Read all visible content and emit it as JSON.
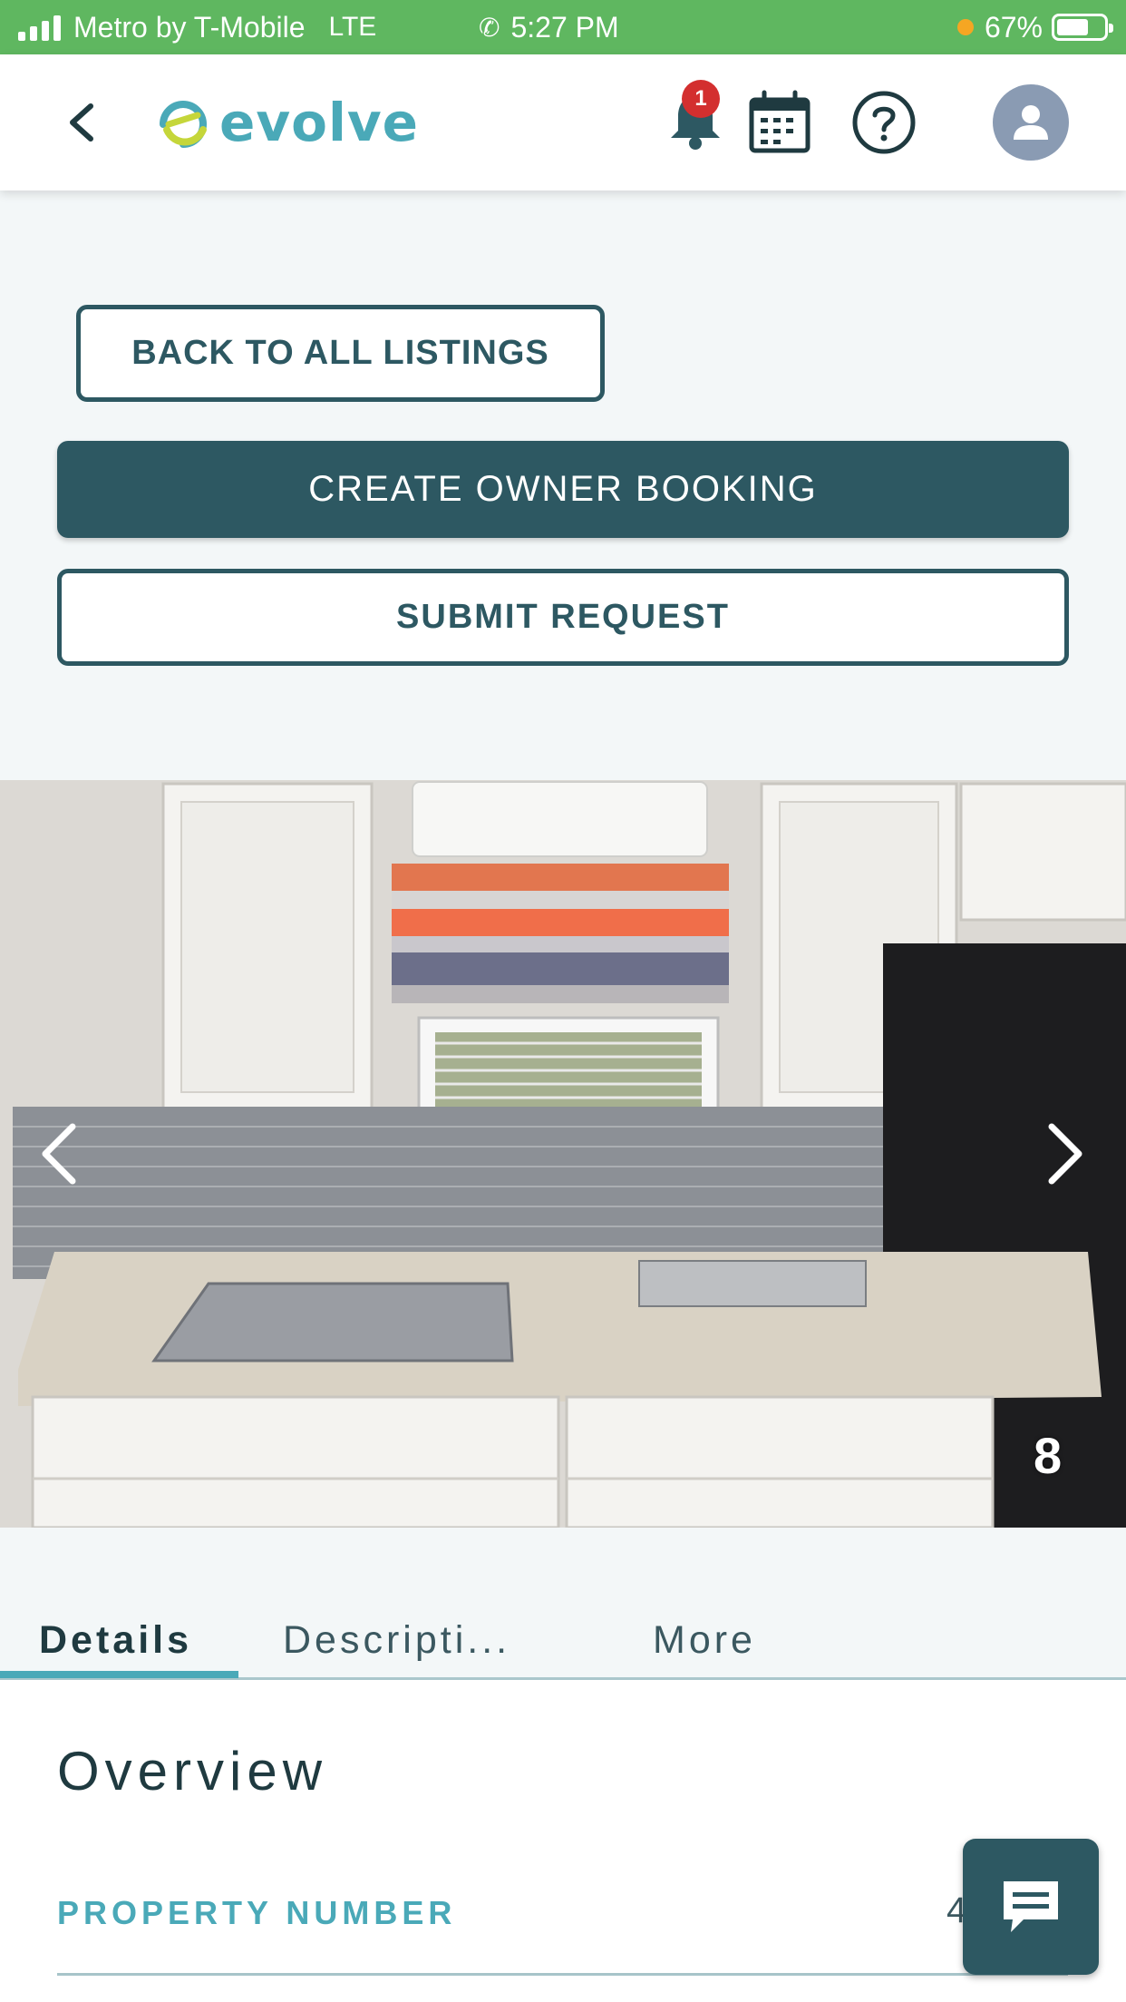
{
  "status_bar": {
    "carrier": "Metro by T-Mobile",
    "network": "LTE",
    "time": "5:27 PM",
    "battery": "67%",
    "battery_level": 0.67
  },
  "header": {
    "logo_text": "evolve",
    "notification_count": "1",
    "icons": [
      "back-chevron-icon",
      "bell-icon",
      "calendar-icon",
      "help-icon",
      "user-avatar-icon"
    ]
  },
  "actions": {
    "back_to_listings": "BACK TO ALL LISTINGS",
    "create_owner_booking": "CREATE OWNER BOOKING",
    "submit_request": "SUBMIT REQUEST"
  },
  "gallery": {
    "photo_number": "8",
    "prev_icon": "chevron-left-icon",
    "next_icon": "chevron-right-icon"
  },
  "tabs": [
    {
      "label": "Details",
      "active": true
    },
    {
      "label": "Descripti...",
      "active": false
    },
    {
      "label": "More",
      "active": false
    }
  ],
  "details": {
    "section_title": "Overview",
    "property_number_label": "PROPERTY NUMBER",
    "property_number_value": "4"
  },
  "colors": {
    "primary": "#2d5862",
    "accent": "#4aa9b8",
    "status_bar": "#5fb760",
    "badge": "#d32f2f"
  }
}
